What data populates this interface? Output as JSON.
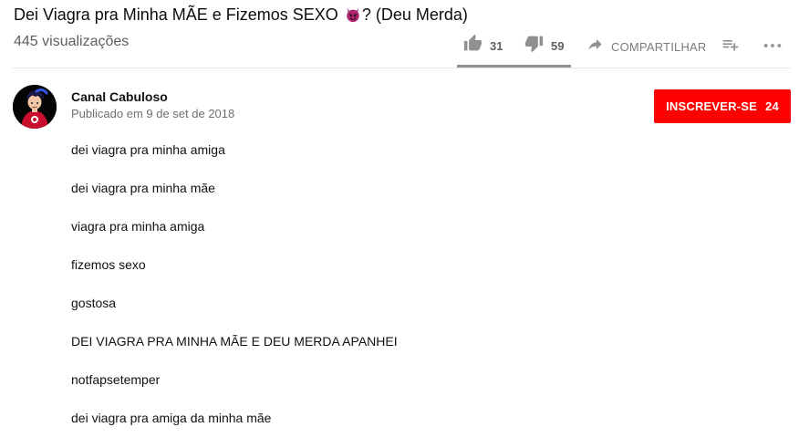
{
  "video": {
    "title_before": "Dei Viagra pra Minha MÃE e Fizemos SEXO ",
    "title_emoji": "devil-face",
    "title_after": "? (Deu Merda)",
    "views": "445 visualizações"
  },
  "actions": {
    "like_count": "31",
    "dislike_count": "59",
    "share_label": "COMPARTILHAR",
    "like_ratio": 0.34
  },
  "channel": {
    "name": "Canal Cabuloso",
    "published": "Publicado em 9 de set de 2018",
    "subscribe_label": "INSCREVER-SE",
    "subscriber_count": "24"
  },
  "description": [
    "dei viagra pra minha amiga",
    "dei viagra pra minha mãe",
    "viagra pra minha amiga",
    "fizemos sexo",
    "gostosa",
    "DEI VIAGRA PRA MINHA MÃE E DEU MERDA APANHEI",
    "notfapsetemper",
    "dei viagra pra amiga da minha mãe"
  ],
  "colors": {
    "subscribe_bg": "#ff0000",
    "icon_gray": "#909090",
    "text_secondary": "#606060"
  },
  "icons": [
    "devil-face-icon",
    "like-icon",
    "dislike-icon",
    "share-icon",
    "add-to-playlist-icon",
    "more-icon"
  ]
}
